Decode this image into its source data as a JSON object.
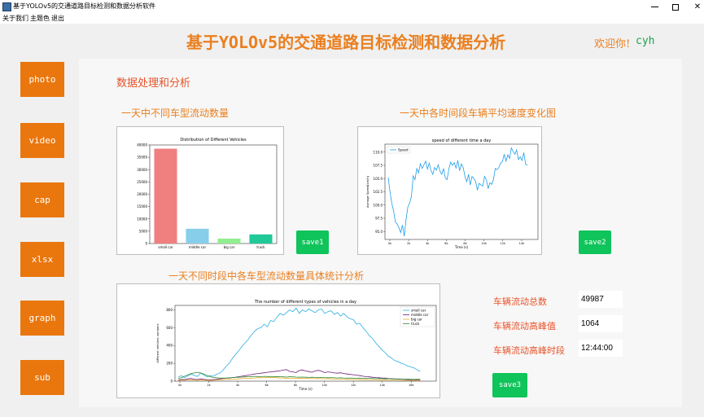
{
  "window": {
    "title": "基于YOLOv5的交通道路目标检测和数据分析软件",
    "controls": {
      "minimize_icon": "minimize-icon",
      "maximize_icon": "maximize-icon",
      "close_icon": "close-icon",
      "close_glyph": "✕"
    }
  },
  "menu": [
    "关于我们",
    "主题色",
    "退出"
  ],
  "header": {
    "title": "基于YOLOv5的交通道路目标检测和数据分析",
    "welcome": "欢迎你!",
    "user": "cyh"
  },
  "sidebar": [
    {
      "label": "photo"
    },
    {
      "label": "video"
    },
    {
      "label": "cap"
    },
    {
      "label": "xlsx"
    },
    {
      "label": "graph"
    },
    {
      "label": "sub"
    }
  ],
  "main": {
    "section_title": "数据处理和分析",
    "vehicle_chart_title": "一天中不同车型流动数量",
    "speed_chart_title": "一天中各时间段车辆平均速度变化图",
    "timeline_chart_title": "一天不同时段中各车型流动数量具体统计分析",
    "save_buttons": [
      "save1",
      "save2",
      "save3"
    ],
    "stats": [
      {
        "label": "车辆流动总数",
        "value": "49987"
      },
      {
        "label": "车辆流动高峰值",
        "value": "1064"
      },
      {
        "label": "车辆流动高峰时段",
        "value": "12:44:00"
      }
    ]
  },
  "chart_data": [
    {
      "type": "bar",
      "title": "Distribution of Different Vehicles",
      "categories": [
        "small car",
        "middle car",
        "big car",
        "truck"
      ],
      "values": [
        38500,
        6000,
        2000,
        3700
      ],
      "colors": [
        "#f08080",
        "#87ceeb",
        "#90ee90",
        "#20c997"
      ],
      "ylim": [
        0,
        40000
      ],
      "yticks": [
        "0",
        "5000",
        "10000",
        "15000",
        "20000",
        "25000",
        "30000",
        "35000",
        "40000"
      ]
    },
    {
      "type": "line",
      "title": "speed of different time a day",
      "xlabel": "Time (s)",
      "ylabel": "Average Speed(km/h)",
      "ylim": [
        93.5,
        111.5
      ],
      "yticks": [
        "95.0",
        "97.5",
        "100.0",
        "102.5",
        "105.0",
        "107.5",
        "110.0"
      ],
      "xticks": [
        "0k",
        "2k",
        "4k",
        "6k",
        "8k",
        "10k",
        "12k",
        "14k"
      ],
      "legend": "top-left",
      "series": [
        {
          "name": "Speed",
          "color": "#1f9ee8",
          "values": [
            105.2,
            102.5,
            100.3,
            98.9,
            96.8,
            96.4,
            95.7,
            94.8,
            96.2,
            94.1,
            97.3,
            99.6,
            100.4,
            101.6,
            105.5,
            104.8,
            106.9,
            106.1,
            107.8,
            106.9,
            107.6,
            108.3,
            106.8,
            107.9,
            106.5,
            105.8,
            107.1,
            106.6,
            107.6,
            106.4,
            105.8,
            106.9,
            105.1,
            104.8,
            106.8,
            108.1,
            107.5,
            108.0,
            107.0,
            108.4,
            106.5,
            107.8,
            107.1,
            105.4,
            104.4,
            105.8,
            103.8,
            105.4,
            105.0,
            104.5,
            102.8,
            104.1,
            103.8,
            103.6,
            105.4,
            104.8,
            103.1,
            104.2,
            103.9,
            104.8,
            106.9,
            106.7,
            107.1,
            107.9,
            108.2,
            109.6,
            108.3,
            109.5,
            108.8,
            110.8,
            110.1,
            109.6,
            110.4,
            108.6,
            109.1,
            108.4,
            109.9,
            107.7,
            107.5
          ]
        }
      ]
    },
    {
      "type": "line",
      "title": "The number of different types of vehicles in a day",
      "xlabel": "Time (s)",
      "ylabel": "different vehicles numbers",
      "ylim": [
        0,
        850
      ],
      "yticks": [
        "0",
        "200",
        "400",
        "600",
        "800"
      ],
      "xticks": [
        "0k",
        "2k",
        "4k",
        "6k",
        "8k",
        "10k",
        "12k",
        "14k",
        "16k"
      ],
      "legend": "top-right",
      "series": [
        {
          "name": "small car",
          "color": "#29aee0",
          "values": [
            45,
            62,
            38,
            58,
            80,
            65,
            52,
            90,
            70,
            48,
            62,
            55,
            78,
            90,
            120,
            165,
            200,
            255,
            300,
            340,
            390,
            430,
            470,
            520,
            560,
            590,
            600,
            640,
            610,
            680,
            670,
            720,
            760,
            740,
            770,
            800,
            780,
            820,
            760,
            800,
            780,
            810,
            790,
            770,
            800,
            810,
            760,
            780,
            790,
            750,
            770,
            730,
            760,
            720,
            700,
            690,
            640,
            650,
            600,
            560,
            510,
            480,
            430,
            390,
            350,
            320,
            280,
            260,
            230,
            220,
            200,
            190,
            170,
            160,
            150,
            130,
            110
          ]
        },
        {
          "name": "middle car",
          "color": "#6f1d7a",
          "values": [
            12,
            20,
            16,
            25,
            30,
            22,
            18,
            26,
            20,
            16,
            15,
            18,
            20,
            26,
            30,
            34,
            36,
            40,
            44,
            50,
            56,
            62,
            68,
            74,
            80,
            86,
            90,
            94,
            100,
            104,
            108,
            112,
            118,
            124,
            130,
            110,
            104,
            96,
            120,
            126,
            114,
            108,
            100,
            115,
            122,
            112,
            96,
            104,
            100,
            92,
            90,
            94,
            86,
            80,
            76,
            72,
            68,
            62,
            56,
            50,
            48,
            44,
            40,
            38,
            34,
            36,
            30,
            28,
            26,
            24,
            22,
            20,
            18,
            16,
            16,
            14,
            12
          ]
        },
        {
          "name": "big car",
          "color": "#e8a92a",
          "values": [
            8,
            12,
            10,
            14,
            16,
            12,
            10,
            14,
            12,
            10,
            8,
            10,
            12,
            14,
            16,
            18,
            20,
            22,
            24,
            26,
            28,
            30,
            32,
            34,
            36,
            38,
            38,
            40,
            40,
            42,
            40,
            38,
            36,
            36,
            34,
            34,
            32,
            32,
            30,
            32,
            30,
            30,
            28,
            28,
            30,
            28,
            26,
            28,
            26,
            24,
            24,
            22,
            22,
            20,
            20,
            18,
            18,
            16,
            16,
            16,
            14,
            14,
            14,
            12,
            12,
            12,
            10,
            10,
            10,
            10,
            8,
            8,
            8,
            8,
            8,
            6,
            6
          ]
        },
        {
          "name": "truck",
          "color": "#2e8b2e",
          "values": [
            28,
            40,
            55,
            70,
            85,
            92,
            100,
            92,
            80,
            65,
            50,
            42,
            38,
            36,
            34,
            36,
            38,
            40,
            42,
            44,
            46,
            48,
            50,
            52,
            54,
            52,
            50,
            54,
            52,
            50,
            48,
            52,
            50,
            48,
            46,
            50,
            48,
            46,
            44,
            46,
            44,
            42,
            44,
            42,
            40,
            42,
            40,
            38,
            40,
            38,
            36,
            38,
            36,
            34,
            36,
            34,
            32,
            34,
            32,
            30,
            32,
            30,
            28,
            30,
            28,
            26,
            28,
            26,
            24,
            26,
            24,
            22,
            24,
            22,
            20,
            22,
            20
          ]
        }
      ]
    }
  ]
}
